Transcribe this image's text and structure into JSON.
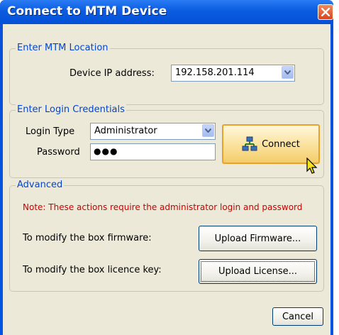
{
  "window": {
    "title": "Connect to MTM Device",
    "close_icon": "close-icon"
  },
  "location": {
    "legend": "Enter MTM Location",
    "ip_label": "Device IP address:",
    "ip_value": "192.158.201.114"
  },
  "credentials": {
    "legend": "Enter Login Credentials",
    "login_type_label": "Login Type",
    "login_type_value": "Administrator",
    "password_label": "Password",
    "password_value": "●●●",
    "connect_label": "Connect",
    "connect_icon": "network-icon"
  },
  "advanced": {
    "legend": "Advanced",
    "note": "Note: These actions require the administrator login and password",
    "firmware_label": "To modify the box firmware:",
    "firmware_button": "Upload Firmware...",
    "license_label": "To modify the box licence key:",
    "license_button": "Upload License..."
  },
  "footer": {
    "cancel_label": "Cancel"
  },
  "colors": {
    "titlebar": "#0450d8",
    "legend": "#0046d5",
    "note": "#cc0000",
    "connect_border": "#e8a12a"
  }
}
